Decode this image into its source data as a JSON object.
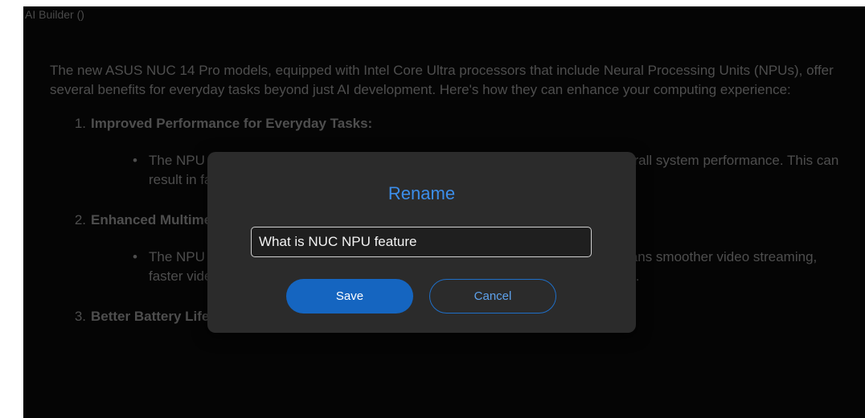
{
  "app": {
    "title": "AI Builder ()"
  },
  "content": {
    "intro": "The new ASUS NUC 14 Pro models, equipped with Intel Core Ultra processors that include Neural Processing Units (NPUs), offer several benefits for everyday tasks beyond just AI development. Here's how they can enhance your computing experience:",
    "items": [
      {
        "number": "1.",
        "title": "Improved Performance for Everyday Tasks:",
        "bullet": "The NPU can offload certain tasks from the CPU and GPU, leading to better overall system performance. This can result in faster boot times, quicker app launches, and smoother multitasking."
      },
      {
        "number": "2.",
        "title": "Enhanced Multimedia Experience:",
        "bullet": "The NPU can accelerate tasks related to video encoding and playback. This means smoother video streaming, faster video editing, and better support for high-resolution content like 4K and 8K."
      },
      {
        "number": "3.",
        "title": "Better Battery Life on Mobile Devices:"
      }
    ]
  },
  "dialog": {
    "title": "Rename",
    "input_value": "What is NUC NPU feature",
    "save_label": "Save",
    "cancel_label": "Cancel"
  },
  "colors": {
    "accent": "#3c8eea",
    "save_button": "#1565c0",
    "dialog_background": "#2b2b2b",
    "page_background": "#050505"
  }
}
